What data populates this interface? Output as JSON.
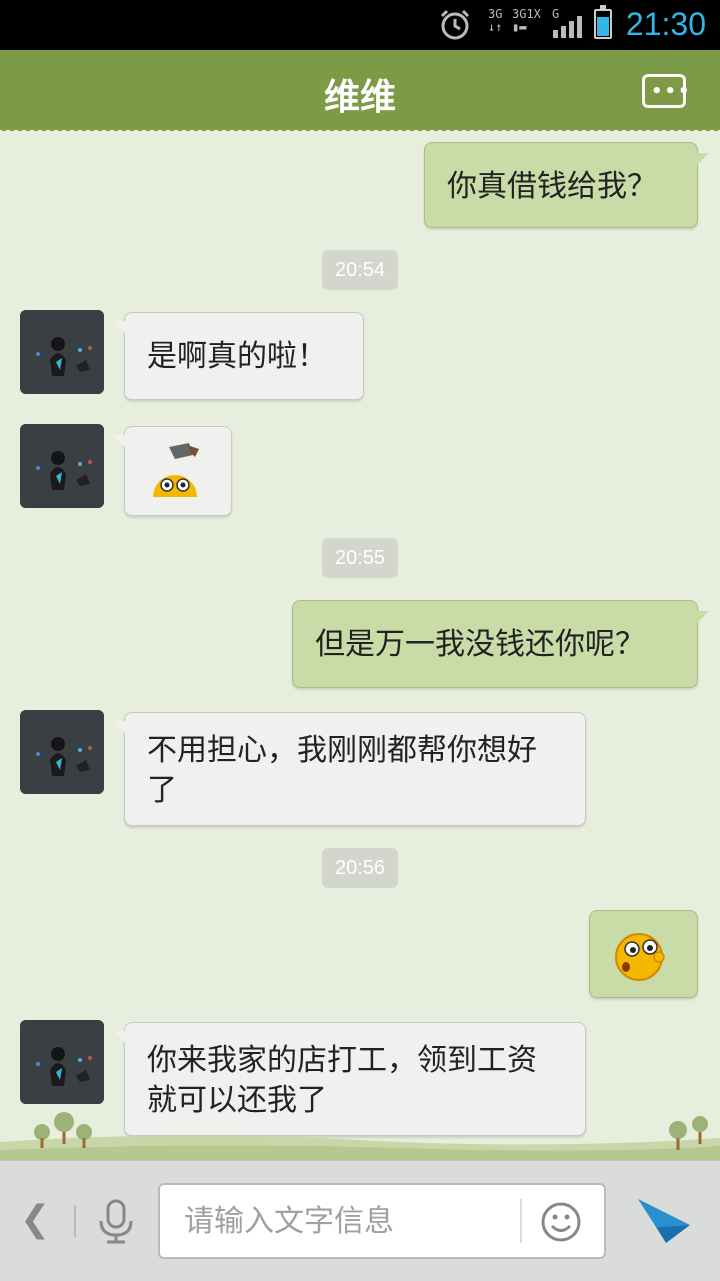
{
  "status_bar": {
    "time": "21:30",
    "net_labels": [
      "3G",
      "3G",
      "1X",
      "G"
    ],
    "accent": "#35b5e5",
    "battery_level": 0.75
  },
  "header": {
    "title": "维维",
    "more_icon": "chat-more-icon"
  },
  "messages": [
    {
      "side": "me",
      "type": "text",
      "text": "你真借钱给我？"
    },
    {
      "type": "time",
      "text": "20:54"
    },
    {
      "side": "other",
      "type": "text",
      "text": "是啊真的啦！"
    },
    {
      "side": "other",
      "type": "emoji",
      "emoji": "axe-head-emoji"
    },
    {
      "type": "time",
      "text": "20:55"
    },
    {
      "side": "me",
      "type": "text",
      "text": "但是万一我没钱还你呢？"
    },
    {
      "side": "other",
      "type": "text",
      "text": "不用担心，我刚刚都帮你想好了"
    },
    {
      "type": "time",
      "text": "20:56"
    },
    {
      "side": "me",
      "type": "emoji",
      "emoji": "surprised-face-emoji"
    },
    {
      "side": "other",
      "type": "text",
      "text": "你来我家的店打工，领到工资就可以还我了"
    }
  ],
  "input_bar": {
    "placeholder": "请输入文字信息",
    "back_icon": "chevron-left-icon",
    "mic_icon": "microphone-icon",
    "emoji_icon": "smiley-icon",
    "send_icon": "send-arrow-icon"
  },
  "colors": {
    "header": "#7d9a47",
    "background": "#e8eedd",
    "bubble_me": "#c9dca8",
    "bubble_other": "#f0f0ef"
  }
}
